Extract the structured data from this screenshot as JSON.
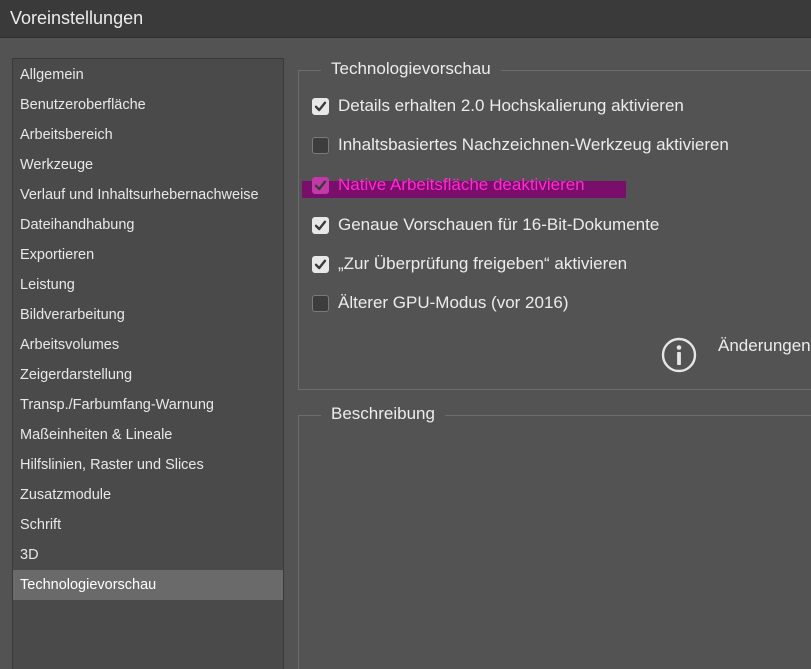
{
  "window": {
    "title": "Voreinstellungen"
  },
  "sidebar": {
    "items": [
      {
        "label": "Allgemein",
        "selected": false
      },
      {
        "label": "Benutzeroberfläche",
        "selected": false
      },
      {
        "label": "Arbeitsbereich",
        "selected": false
      },
      {
        "label": "Werkzeuge",
        "selected": false
      },
      {
        "label": "Verlauf und Inhaltsurhebernachweise",
        "selected": false
      },
      {
        "label": "Dateihandhabung",
        "selected": false
      },
      {
        "label": "Exportieren",
        "selected": false
      },
      {
        "label": "Leistung",
        "selected": false
      },
      {
        "label": "Bildverarbeitung",
        "selected": false
      },
      {
        "label": "Arbeitsvolumes",
        "selected": false
      },
      {
        "label": "Zeigerdarstellung",
        "selected": false
      },
      {
        "label": "Transp./Farbumfang-Warnung",
        "selected": false
      },
      {
        "label": "Maßeinheiten & Lineale",
        "selected": false
      },
      {
        "label": "Hilfslinien, Raster und Slices",
        "selected": false
      },
      {
        "label": "Zusatzmodule",
        "selected": false
      },
      {
        "label": "Schrift",
        "selected": false
      },
      {
        "label": "3D",
        "selected": false
      },
      {
        "label": "Technologievorschau",
        "selected": true
      }
    ]
  },
  "tech_preview": {
    "title": "Technologievorschau",
    "options": [
      {
        "label": "Details erhalten 2.0 Hochskalierung aktivieren",
        "checked": true
      },
      {
        "label": "Inhaltsbasiertes Nachzeichnen-Werkzeug aktivieren",
        "checked": false
      },
      {
        "label": "Native Arbeitsfläche deaktivieren",
        "checked": true
      },
      {
        "label": "Genaue Vorschauen für 16-Bit-Dokumente",
        "checked": true
      },
      {
        "label": "„Zur Überprüfung freigeben“ aktivieren",
        "checked": true
      },
      {
        "label": "Älterer GPU-Modus (vor 2016)",
        "checked": false
      }
    ],
    "info_text": "Änderungen",
    "info_icon": "info-icon",
    "highlight_color": "#7a0f6b",
    "highlight_text_color": "#ff2ad0"
  },
  "description": {
    "title": "Beschreibung"
  }
}
